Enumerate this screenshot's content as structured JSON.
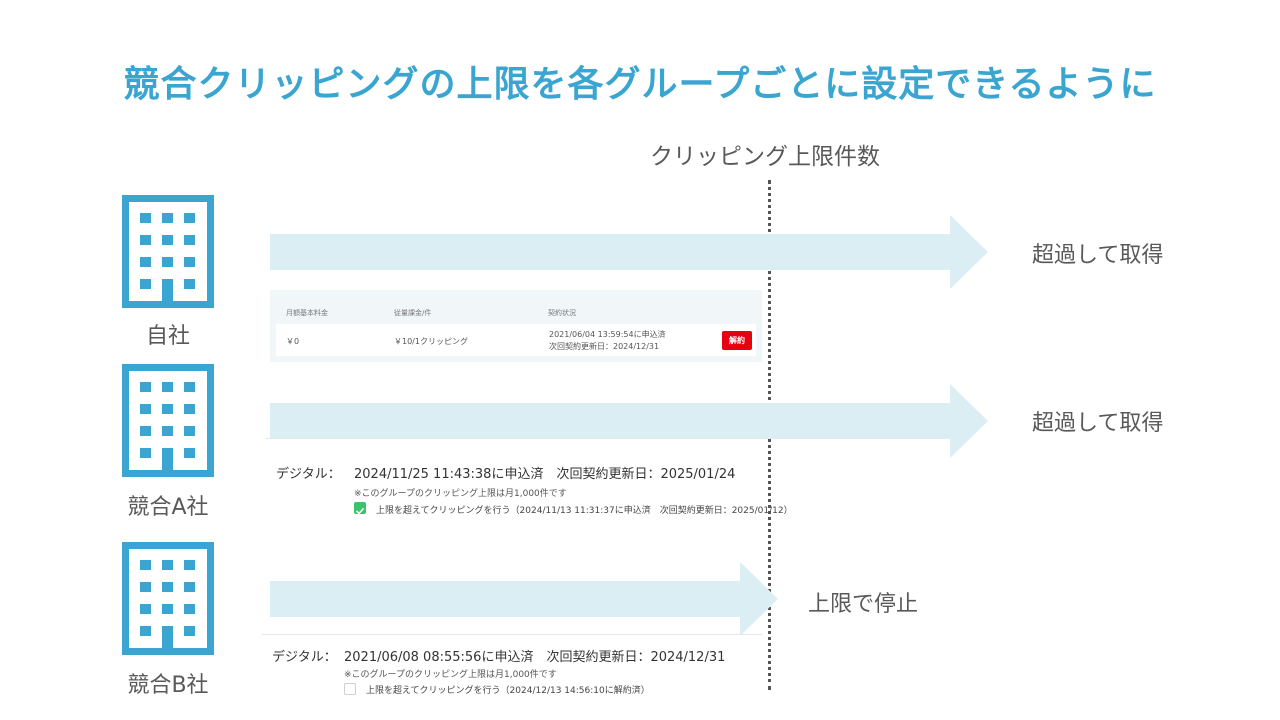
{
  "title": "競合クリッピングの上限を各グループごとに設定できるように",
  "limit_label": "クリッピング上限件数",
  "colors": {
    "accent": "#3aa5d0",
    "arrow": "#dbeef3",
    "cancel": "#e60012",
    "check": "#3cc26a"
  },
  "rows": [
    {
      "company": "自社",
      "result": "超過して取得"
    },
    {
      "company": "競合A社",
      "result": "超過して取得"
    },
    {
      "company": "競合B社",
      "result": "上限で停止"
    }
  ],
  "panel1": {
    "headers": [
      "月額基本料金",
      "従量課金/件",
      "契約状況"
    ],
    "base_fee": "￥0",
    "unit_fee": "￥10/1クリッピング",
    "status_line1": "2021/06/04 13:59:54に申込済",
    "status_line2": "次回契約更新日：2024/12/31",
    "cancel_label": "解約"
  },
  "panel2": {
    "label": "デジタル：",
    "main": "2024/11/25 11:43:38に申込済　次回契約更新日：2025/01/24",
    "note": "※このグループのクリッピング上限は月1,000件です",
    "check_label": "上限を超えてクリッピングを行う（2024/11/13 11:31:37に申込済　次回契約更新日：2025/01/12）",
    "checked": true
  },
  "panel3": {
    "label": "デジタル：",
    "main": "2021/06/08 08:55:56に申込済　次回契約更新日：2024/12/31",
    "note": "※このグループのクリッピング上限は月1,000件です",
    "check_label": "上限を超えてクリッピングを行う（2024/12/13 14:56:10に解約済）",
    "checked": false
  }
}
